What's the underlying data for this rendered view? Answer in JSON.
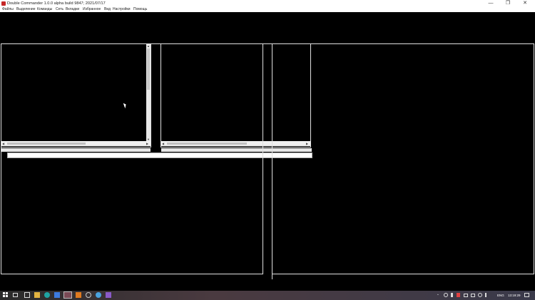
{
  "window": {
    "title": "Double Commander 1.0.0 alpha build 9847; 2021/07/17",
    "minimize_icon": "minimize-icon",
    "maximize_icon": "maximize-icon",
    "close_icon": "close-icon",
    "min_glyph": "—",
    "max_glyph": "❐",
    "close_glyph": "✕"
  },
  "menu": {
    "items": [
      "Файлы",
      "Выделение",
      "Команды",
      "Сеть",
      "Вкладки",
      "Избранное",
      "Вид",
      "Настройки",
      "Помощь"
    ]
  },
  "taskbar": {
    "language": "ENG",
    "time": "13:19:29",
    "icons": [
      "windows-start-icon",
      "task-view-icon",
      "file-explorer-icon",
      "edge-icon",
      "store-icon",
      "double-commander-icon",
      "app-icon",
      "settings-icon",
      "chrome-icon",
      "visual-studio-icon"
    ],
    "tray_icons": [
      "chevron-up-icon",
      "network-icon",
      "volume-icon",
      "battery-icon",
      "notification-icon"
    ]
  },
  "colors": {
    "accent": "#c62828",
    "background": "#000000",
    "panel_border": "#e0e0e0"
  }
}
